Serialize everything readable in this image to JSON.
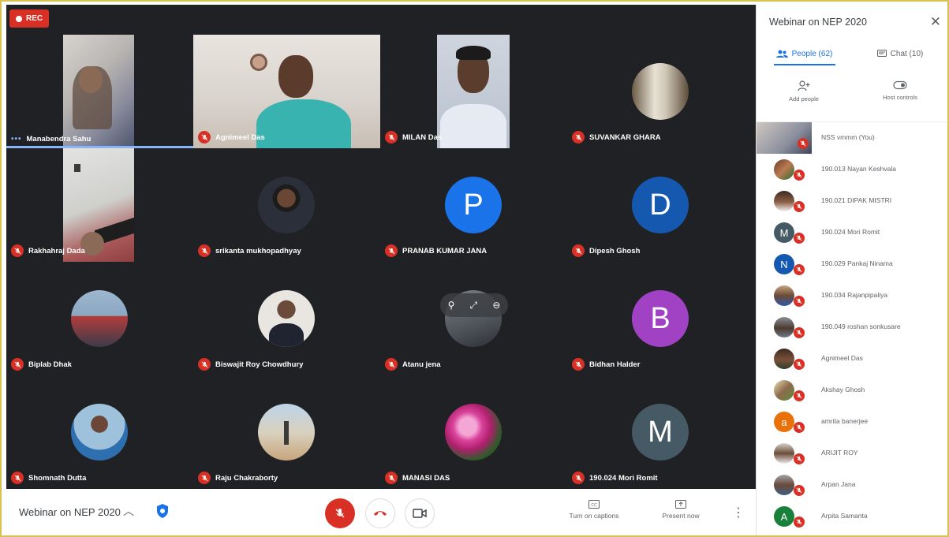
{
  "recording": {
    "label": "REC"
  },
  "tiles": [
    {
      "name": "Manabendra Sahu",
      "muted": false,
      "speaking": true,
      "kind": "camera"
    },
    {
      "name": "Agnimeel Das",
      "muted": true,
      "kind": "camera"
    },
    {
      "name": "MILAN Das",
      "muted": true,
      "kind": "camera"
    },
    {
      "name": "SUVANKAR GHARA",
      "muted": true,
      "kind": "photo"
    },
    {
      "name": "Rakhahraj Dada",
      "muted": true,
      "kind": "camera"
    },
    {
      "name": "srikanta mukhopadhyay",
      "muted": true,
      "kind": "photo"
    },
    {
      "name": "PRANAB KUMAR JANA",
      "muted": true,
      "kind": "letter",
      "letter": "P",
      "color": "#1a73e8"
    },
    {
      "name": "Dipesh Ghosh",
      "muted": true,
      "kind": "letter",
      "letter": "D",
      "color": "#1558b0"
    },
    {
      "name": "Biplab Dhak",
      "muted": true,
      "kind": "photo"
    },
    {
      "name": "Biswajit Roy Chowdhury",
      "muted": true,
      "kind": "photo"
    },
    {
      "name": "Atanu jena",
      "muted": true,
      "kind": "photo",
      "hover": true
    },
    {
      "name": "Bidhan Halder",
      "muted": true,
      "kind": "letter",
      "letter": "B",
      "color": "#a142c4"
    },
    {
      "name": "Shomnath Dutta",
      "muted": true,
      "kind": "photo"
    },
    {
      "name": "Raju Chakraborty",
      "muted": true,
      "kind": "photo"
    },
    {
      "name": "MANASI DAS",
      "muted": true,
      "kind": "photo"
    },
    {
      "name": "190.024 Mori Romit",
      "muted": true,
      "kind": "letter",
      "letter": "M",
      "color": "#455a64"
    }
  ],
  "bottom_bar": {
    "meeting_title": "Webinar on NEP 2020",
    "captions_label": "Turn on captions",
    "present_label": "Present now"
  },
  "panel": {
    "title": "Webinar on NEP 2020",
    "people_tab": "People (62)",
    "chat_tab": "Chat (10)",
    "add_people": "Add people",
    "host_controls": "Host controls",
    "people": [
      {
        "name": "NSS vmmm (You)",
        "kind": "self"
      },
      {
        "name": "190.013 Nayan Keshvala",
        "kind": "photo"
      },
      {
        "name": "190.021 DIPAK MISTRI",
        "kind": "photo"
      },
      {
        "name": "190.024 Mori Romit",
        "kind": "letter",
        "letter": "M",
        "color": "#455a64"
      },
      {
        "name": "190.029 Pankaj Ninama",
        "kind": "letter",
        "letter": "N",
        "color": "#1558b0"
      },
      {
        "name": "190.034 Rajanpipaliya",
        "kind": "photo"
      },
      {
        "name": "190.049 roshan sonkusare",
        "kind": "photo"
      },
      {
        "name": "Agnimeel Das",
        "kind": "photo"
      },
      {
        "name": "Akshay Ghosh",
        "kind": "photo"
      },
      {
        "name": "amrita banerjee",
        "kind": "letter",
        "letter": "a",
        "color": "#e8710a"
      },
      {
        "name": "ARIJIT ROY",
        "kind": "photo"
      },
      {
        "name": "Arpan Jana",
        "kind": "photo"
      },
      {
        "name": "Arpita Samanta",
        "kind": "letter",
        "letter": "A",
        "color": "#188038"
      }
    ]
  }
}
